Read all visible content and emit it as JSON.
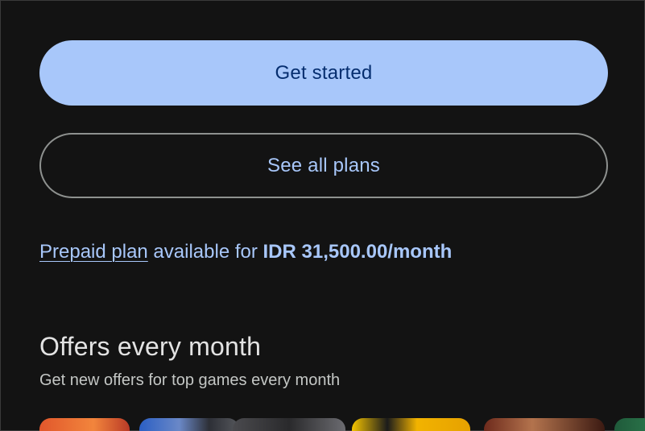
{
  "actions": {
    "get_started_label": "Get started",
    "see_all_plans_label": "See all plans"
  },
  "prepaid": {
    "link_text": "Prepaid plan",
    "middle_text": " available for ",
    "price": "IDR 31,500.00/month"
  },
  "offers": {
    "title": "Offers every month",
    "subtitle": "Get new offers for top games every month"
  },
  "colors": {
    "background": "#131313",
    "primary_button": "#a8c7fa",
    "primary_button_text": "#062e6f",
    "accent_text": "#a8c7fa"
  }
}
